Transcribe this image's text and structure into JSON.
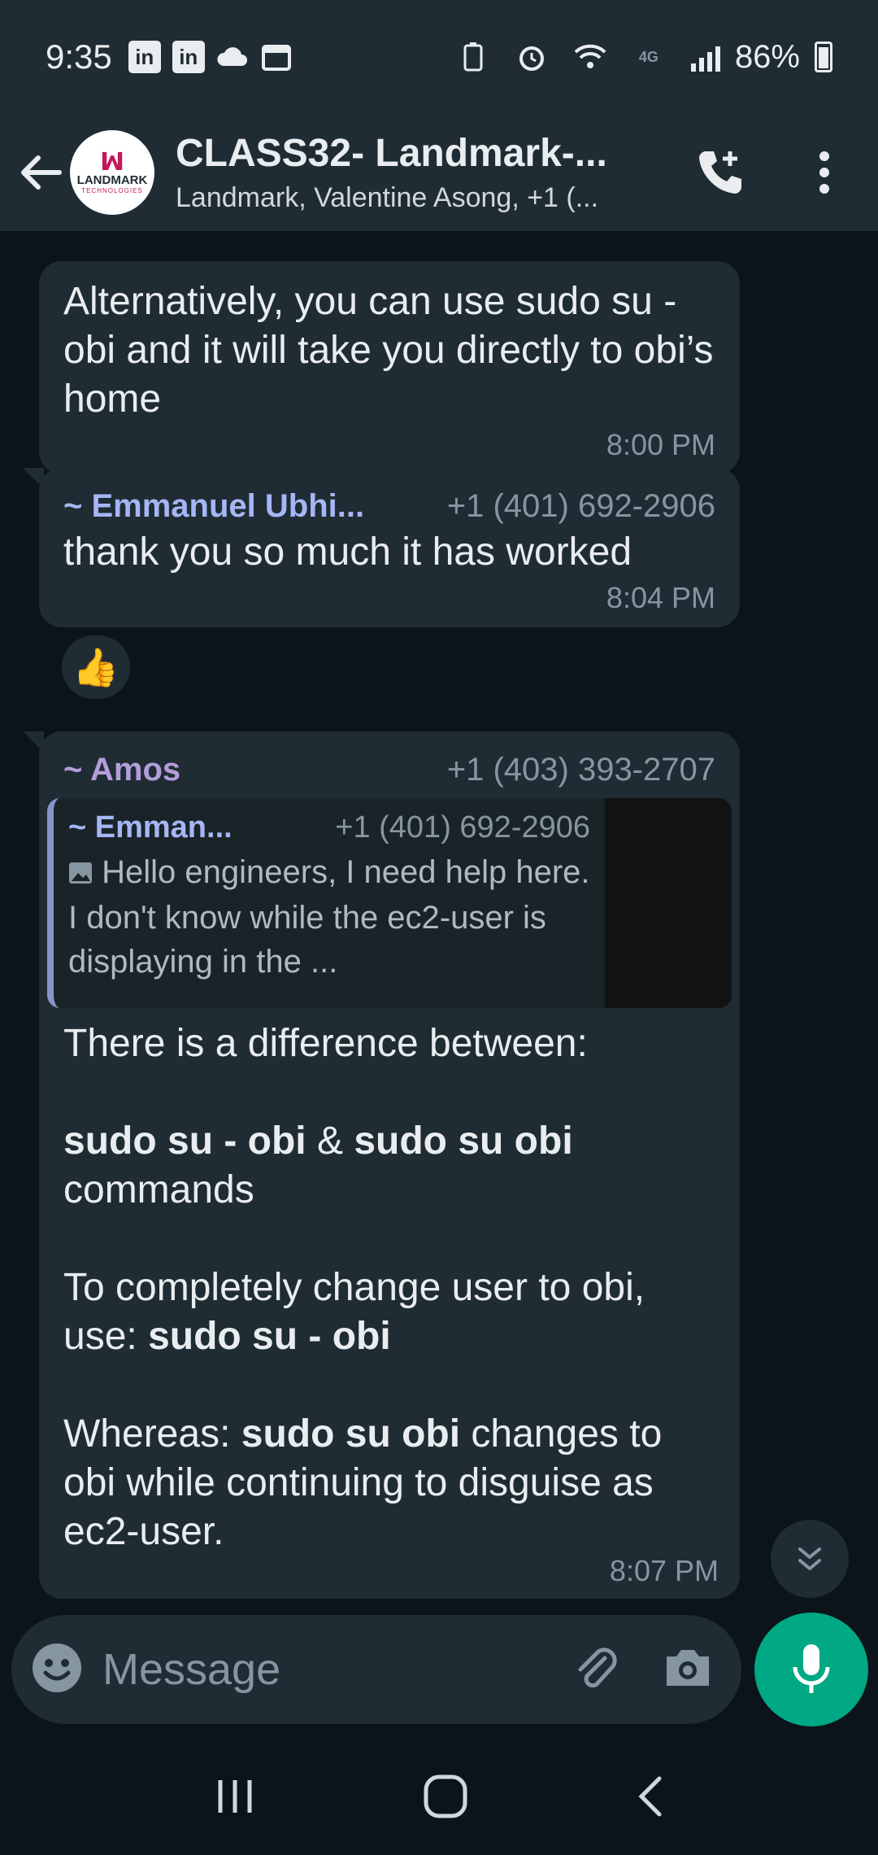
{
  "status_bar": {
    "time": "9:35",
    "battery": "86%"
  },
  "header": {
    "title": "CLASS32- Landmark-...",
    "subtitle": "Landmark, Valentine Asong, +1 (...",
    "avatar_text": "LANDMARK",
    "avatar_sub": "TECHNOLOGIES"
  },
  "messages": [
    {
      "text": "Alternatively, you can use sudo su - obi and it will take you directly to obi’s home",
      "time": "8:00 PM"
    },
    {
      "sender": "~ Emmanuel Ubhi...",
      "phone": "+1 (401) 692-2906",
      "sender_color": "#a6b6f4",
      "text": "thank you so much it has worked",
      "time": "8:04 PM",
      "reaction": "👍"
    },
    {
      "sender": "~ Amos",
      "phone": "+1 (403) 393-2707",
      "sender_color": "#b39ddb",
      "quote": {
        "sender": "~ Emman...",
        "phone": "+1 (401) 692-2906",
        "text": "Hello engineers, I need help here. I don't know while the ec2-user is displaying in the ..."
      },
      "body": {
        "line1": "There is a difference between:",
        "cmd_a": "sudo su - obi",
        "amp": " & ",
        "cmd_b": "sudo su obi",
        "line2_tail": "commands",
        "line3": "To completely change user to obi, use: ",
        "cmd_c": "sudo su - obi",
        "line4_prefix": "Whereas: ",
        "cmd_d": "sudo su obi",
        "line4_tail": " changes to obi while continuing to disguise as ec2-user."
      },
      "time": "8:07 PM"
    }
  ],
  "input": {
    "placeholder": "Message"
  },
  "icons": {
    "back": "back-arrow-icon",
    "call": "add-call-icon",
    "menu": "more-vert-icon",
    "emoji": "emoji-icon",
    "attach": "attach-icon",
    "camera": "camera-icon",
    "mic": "mic-icon"
  },
  "colors": {
    "accent": "#00a884",
    "bubble": "#202c33",
    "background": "#0b141a"
  }
}
